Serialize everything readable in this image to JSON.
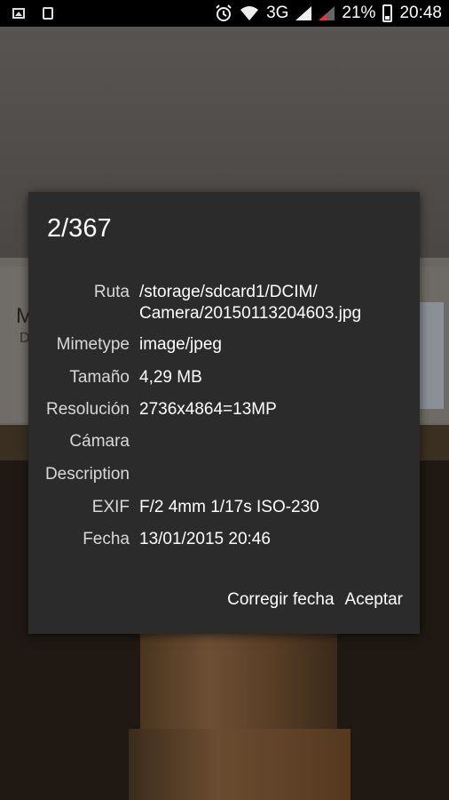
{
  "status_bar": {
    "network": "3G",
    "battery_percent": "21%",
    "time": "20:48",
    "icons": [
      "picture-icon",
      "recycle-icon",
      "alarm-icon",
      "wifi-icon",
      "signal-icon",
      "signal2-icon",
      "battery-icon"
    ]
  },
  "dialog": {
    "title": "2/367",
    "rows": [
      {
        "label": "Ruta",
        "value": "/storage/sdcard1/DCIM/\nCamera/20150113204603.jpg"
      },
      {
        "label": "Mimetype",
        "value": "image/jpeg"
      },
      {
        "label": "Tamaño",
        "value": "4,29 MB"
      },
      {
        "label": "Resolución",
        "value": "2736x4864=13MP"
      },
      {
        "label": "Cámara",
        "value": ""
      },
      {
        "label": "Description",
        "value": ""
      },
      {
        "label": "EXIF",
        "value": "F/2 4mm 1/17s ISO-230"
      },
      {
        "label": "Fecha",
        "value": "13/01/2015 20:46"
      }
    ],
    "buttons": {
      "fix_date": "Corregir fecha",
      "accept": "Aceptar"
    }
  },
  "background_text": {
    "m": "M",
    "d": "D"
  }
}
